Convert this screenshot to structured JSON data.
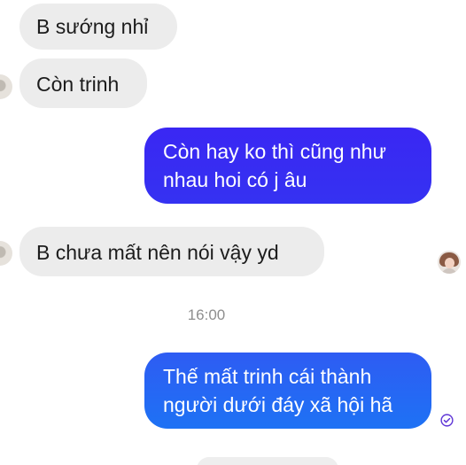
{
  "messages": [
    {
      "id": "m1",
      "direction": "incoming",
      "text": "B sướng nhỉ"
    },
    {
      "id": "m2",
      "direction": "incoming",
      "text": "Còn trinh"
    },
    {
      "id": "m3",
      "direction": "outgoing",
      "lines": [
        "Còn hay ko thì cũng như",
        "nhau hoi có j âu"
      ]
    },
    {
      "id": "m4",
      "direction": "incoming",
      "text": "B chưa mất nên nói vậy yd"
    },
    {
      "id": "m5",
      "direction": "outgoing",
      "lines": [
        "Thế mất trinh cái thành",
        "người dưới đáy xã hội hã"
      ]
    }
  ],
  "timestamp": "16:00",
  "colors": {
    "incoming_bg": "#ececec",
    "outgoing_bg_top": "#3b23f2",
    "outgoing_bg_bottom": "#1877f2",
    "status_check": "#5e35d6"
  },
  "icons": {
    "read_receipt": "check-circle-icon",
    "avatar": "contact-avatar"
  }
}
